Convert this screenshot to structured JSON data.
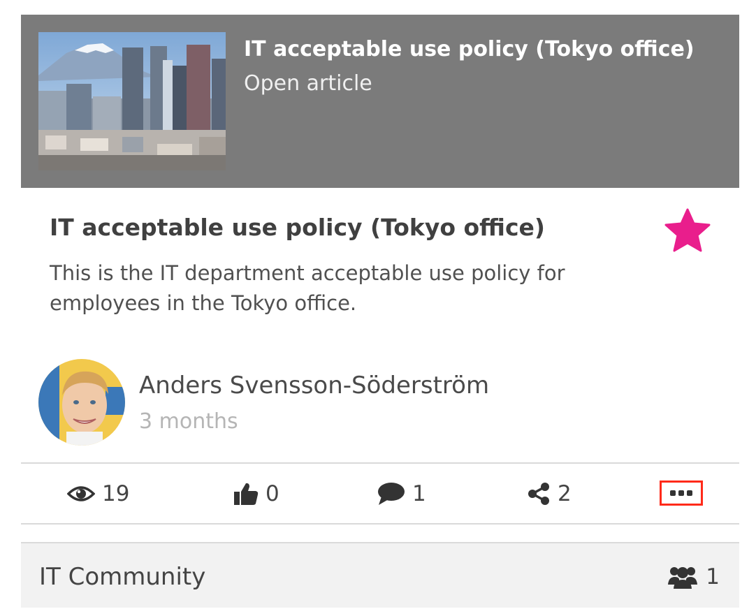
{
  "banner": {
    "title": "IT acceptable use policy (Tokyo office)",
    "subtitle": "Open article"
  },
  "article": {
    "title": "IT acceptable use policy (Tokyo office)",
    "description": "This is the IT department acceptable use policy for employees in the Tokyo office.",
    "favorited": true,
    "star_color": "#e91e8c"
  },
  "author": {
    "name": "Anders Svensson-Söderström",
    "time_ago": "3 months"
  },
  "stats": {
    "views": "19",
    "likes": "0",
    "comments": "1",
    "shares": "2"
  },
  "icons": {
    "views": "eye-icon",
    "likes": "thumbs-up-icon",
    "comments": "comment-icon",
    "shares": "share-icon",
    "more": "ellipsis-icon",
    "members": "users-icon"
  },
  "community": {
    "name": "IT Community",
    "member_count": "1"
  },
  "colors": {
    "banner_bg": "#7b7b7b",
    "highlight_border": "#ff2a1a"
  }
}
